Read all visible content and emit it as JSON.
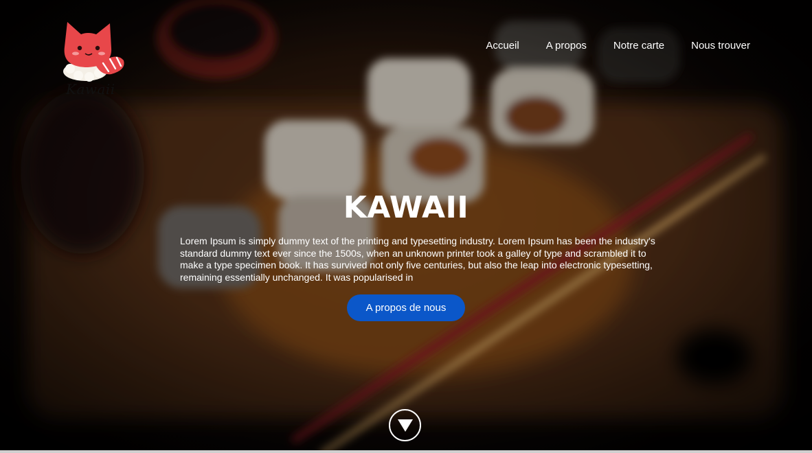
{
  "brand": {
    "logo_text": "Kawaii"
  },
  "nav": {
    "items": [
      {
        "label": "Accueil"
      },
      {
        "label": "A propos"
      },
      {
        "label": "Notre carte"
      },
      {
        "label": "Nous trouver"
      }
    ]
  },
  "hero": {
    "title": "KAWAII",
    "text": "Lorem Ipsum is simply dummy text of the printing and typesetting industry. Lorem Ipsum has been the industry's standard dummy text ever since the 1500s, when an unknown printer took a galley of type and scrambled it to make a type specimen book. It has survived not only five centuries, but also the leap into electronic typesetting, remaining essentially unchanged. It was popularised in",
    "cta_label": "A propos de nous",
    "scroll_icon": "chevron-down-triangle"
  },
  "colors": {
    "accent": "#0b57c9",
    "text": "#ffffff",
    "logo_red": "#e8474a"
  }
}
